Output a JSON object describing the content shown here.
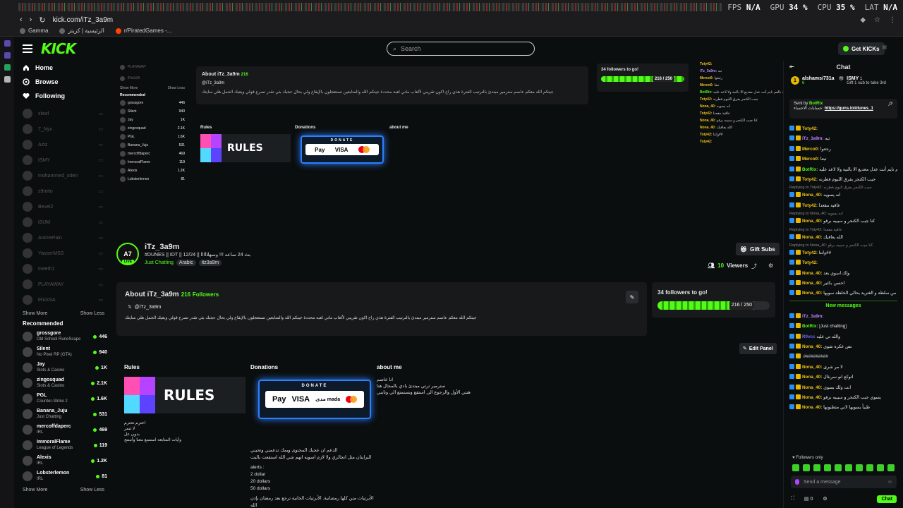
{
  "browser": {
    "url": "kick.com/iTz_3a9m",
    "bookmarks": [
      "Gamma",
      "الرئيسية | كريتر",
      "r/PiratedGames -..."
    ],
    "hud": {
      "fps_label": "FPS",
      "fps": "N/A",
      "gpu_label": "GPU",
      "gpu": "34 %",
      "cpu_label": "CPU",
      "cpu": "35 %",
      "lat_label": "LAT",
      "lat": "N/A"
    }
  },
  "header": {
    "logo": "KICK",
    "search_placeholder": "Search",
    "get_kicks": "Get KICKs"
  },
  "sidebar": {
    "nav": [
      {
        "label": "Home"
      },
      {
        "label": "Browse"
      },
      {
        "label": "Following"
      }
    ],
    "following": [
      "xlxwl",
      "7_Nyx",
      "Aziz",
      "ISMY",
      "mohammed_oden",
      "s9mito",
      "Bevel2",
      "iSUM",
      "AnimePain",
      "YasserMSS",
      "meeth1",
      "PLAYAWAY",
      "iRickSA"
    ],
    "show_more": "Show More",
    "show_less": "Show Less",
    "recommended_title": "Recommended",
    "recommended": [
      {
        "name": "grossgore",
        "category": "Old School RuneScape",
        "viewers": "446"
      },
      {
        "name": "Silent",
        "category": "No Pixel RP (GTA)",
        "viewers": "940"
      },
      {
        "name": "Jay",
        "category": "Slots & Casino",
        "viewers": "1K"
      },
      {
        "name": "zingosquad",
        "category": "Slots & Casino",
        "viewers": "2.1K"
      },
      {
        "name": "PGL",
        "category": "Counter-Strike 2",
        "viewers": "1.6K"
      },
      {
        "name": "Banana_Juju",
        "category": "Just Chatting",
        "viewers": "531"
      },
      {
        "name": "mercoffdaperc",
        "category": "IRL",
        "viewers": "469"
      },
      {
        "name": "ImmoralFlame",
        "category": "League of Legends",
        "viewers": "119"
      },
      {
        "name": "Alexis",
        "category": "IRL",
        "viewers": "1.2K"
      },
      {
        "name": "Lobsterlemon",
        "category": "IRL",
        "viewers": "81"
      }
    ]
  },
  "channel": {
    "avatar_text": "A7",
    "live": "LIVE",
    "name": "iTz_3a9m",
    "title": "#DUNES || IDT || 12/24 || بث 24 ساعه !!! وسهلااااا",
    "category": "Just Chatting",
    "tags": [
      "Arabic",
      "itz3a9m"
    ],
    "gift_subs": "Gift Subs",
    "viewers": "10",
    "viewers_label": "Viewers"
  },
  "about": {
    "title": "About iTz_3a9m",
    "followers": "216",
    "followers_label": "Followers",
    "x_handle": "@iTz_3a9m",
    "description": "جيتكم الله معكم عاصم سترمير مبتدئ بالترتيب الفترة هذي راح اكون تقريبي لألعاب ماني لعبة محددة جيتكم الله والمتابعين تستعجلون بالإيقاع ولي بحال عجبك بثي تقدر تصرع قولي ويعيك الحمل هلي منايتك"
  },
  "goal": {
    "title": "34 followers to go!",
    "progress_label": "216 / 250",
    "progress": 0.864
  },
  "edit_panel": "Edit Panel",
  "panels": {
    "rules_title": "Rules",
    "rules_image_text": "RULES",
    "rules_text": [
      "احترم تحترم",
      "لا تنمر",
      "بدون عل",
      "وأيات المتابعة استمتع معنا وأنبتنج"
    ],
    "donations_title": "Donations",
    "donate_label": "DONATE",
    "donate_pay": "Pay",
    "donate_visa": "VISA",
    "donate_mada": "مدى mada",
    "donations_text_top": [
      "الدعم ان عجبك المحتوى ويمك تدعمني وتحبني",
      "البرايتان مثل اتجالري ولا لازم اسويه انهم شي الله استفعت بالبت"
    ],
    "alerts": [
      "alerts :",
      "2 dollar",
      "20 dollars",
      "50 dollars"
    ],
    "donations_text_bottom": [
      "الأبرتيات متن كلها رمضانية. الأبرتيات الخانية ترجع بعد رمضان بإذن",
      "الله"
    ],
    "about_me_title": "about me",
    "about_me_text": [
      "انا عاصم",
      "سترمير ترتي مبتدئ بادي بالمجال هنا",
      "هنتي الأول والرجوع الى استفع ونستمتع الي وتايني"
    ]
  },
  "chat": {
    "title": "Chat",
    "gifter_rank": "1",
    "gifter_name": "alshamsi731a",
    "gifter_count": "6",
    "top_gift_name": "ISMY",
    "top_gift_count": "1",
    "top_gift_note": "Gift 1 sub to take 3rd",
    "pinned_sender_label": "Sent by",
    "pinned_sender": "BotRix",
    "pinned_prefix": "حسابات الاحساء:",
    "pinned_link": "https://guns.lol/dunes_1",
    "messages": [
      {
        "u": "Toty42:",
        "t": "",
        "c": "#f0c419"
      },
      {
        "u": "iTz_3a9m:",
        "t": "ثبه",
        "c": "#c183ff"
      },
      {
        "u": "Merco0:",
        "t": "رجعوا",
        "c": "#f0c419"
      },
      {
        "u": "Merco0:",
        "t": "تبعا",
        "c": "#f0c419"
      },
      {
        "u": "BotRix:",
        "t": "أي نيتة خاصة بالفم نايم أنت عدل معديع الا بالنية ولا لاعد عليه",
        "c": "#53fc18"
      },
      {
        "u": "Toty42:",
        "t": "جيب الكنجر يفرق الليوم فطرنه",
        "c": "#f0c419"
      },
      {
        "reply": "Replying to Toty42: جيب الكنجر يفرق اليوم فطرنه"
      },
      {
        "u": "Nona_40:",
        "t": "انه يسويه",
        "c": "#f0c419"
      },
      {
        "u": "Toty42:",
        "t": "عاقية مقعدا",
        "c": "#f0c419"
      },
      {
        "reply": "Replying to Nona_40: انه يسويه"
      },
      {
        "u": "Nona_40:",
        "t": "كنا جيب الكنجر و سيبيه برقو",
        "c": "#f0c419"
      },
      {
        "reply": "Replying to Toty42: عاقية مقعدا"
      },
      {
        "u": "Nona_40:",
        "t": "الله يعافيك",
        "c": "#f0c419"
      },
      {
        "reply": "Replying to Nona_40: كنا جيب الكنجر و سيبيه برقو"
      },
      {
        "u": "Toty42:",
        "t": "وانتا##",
        "c": "#f0c419"
      },
      {
        "u": "Toty42:",
        "t": "",
        "c": "#f0c419"
      },
      {
        "u": "Nona_40:",
        "t": "ولك اسوي بعد",
        "c": "#f0c419"
      },
      {
        "u": "Nona_40:",
        "t": "احسن بكثير",
        "c": "#f0c419"
      },
      {
        "u": "Nona_40:",
        "t": "من سلطة و الغترية بحالي الخلطة سويها",
        "c": "#f0c419"
      }
    ],
    "new_messages": "New messages",
    "messages_after": [
      {
        "u": "iTz_3a9m:",
        "t": "",
        "c": "#c183ff"
      },
      {
        "u": "BotRix:",
        "t": "[Just chatting]",
        "c": "#53fc18"
      },
      {
        "u": "R0vcc",
        "t": "والله تي عليه",
        "c": "#6b6bff"
      },
      {
        "u": "Nona_40:",
        "t": "نص عكره شوي",
        "c": "#f0c419"
      },
      {
        "u": "",
        "t": "##########",
        "c": "#fff"
      },
      {
        "u": "Nona_40:",
        "t": "لا مر شرى",
        "c": "#f0c419"
      },
      {
        "u": "Nona_40:",
        "t": "اتوكع انو سربثال",
        "c": "#f0c419"
      },
      {
        "u": "Nona_40:",
        "t": "انت ولك بسوي",
        "c": "#f0c419"
      },
      {
        "u": "Nona_40:",
        "t": "يسوي جيب الكنجر و سيبيه برقو",
        "c": "#f0c419"
      },
      {
        "u": "Nona_40:",
        "t": "طيباً يسويها لاني متطبونها",
        "c": "#f0c419"
      }
    ],
    "followers_only": "Followers only",
    "send_placeholder": "Send a message",
    "kicks_count": "0",
    "chat_button": "Chat"
  }
}
